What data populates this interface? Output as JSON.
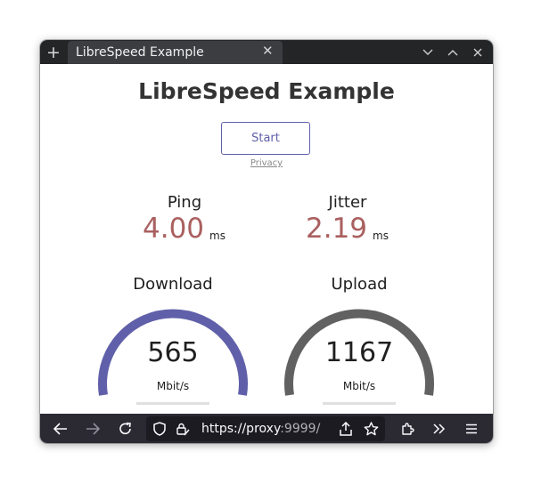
{
  "browser": {
    "new_tab_icon": "plus-icon",
    "tab_title": "LibreSpeed Example",
    "window_controls": [
      "chevron-down-icon",
      "chevron-up-icon",
      "close-icon"
    ]
  },
  "page": {
    "title": "LibreSpeed Example",
    "start_label": "Start",
    "privacy_label": "Privacy",
    "ping": {
      "label": "Ping",
      "value": "4.00",
      "unit": "ms"
    },
    "jitter": {
      "label": "Jitter",
      "value": "2.19",
      "unit": "ms"
    },
    "download": {
      "label": "Download",
      "value": "565",
      "unit": "Mbit/s",
      "gauge_fill": 1.0,
      "color": "#6060aa"
    },
    "upload": {
      "label": "Upload",
      "value": "1167",
      "unit": "Mbit/s",
      "gauge_fill": 1.0,
      "color": "#616161"
    },
    "value_color": "#aa6060"
  },
  "toolbar": {
    "url_host": "https://proxy",
    "url_port": ":9999/",
    "icons": [
      "back-icon",
      "forward-icon",
      "reload-icon",
      "shield-icon",
      "lock-icon",
      "share-icon",
      "star-icon",
      "extensions-icon",
      "overflow-icon",
      "menu-icon"
    ]
  }
}
